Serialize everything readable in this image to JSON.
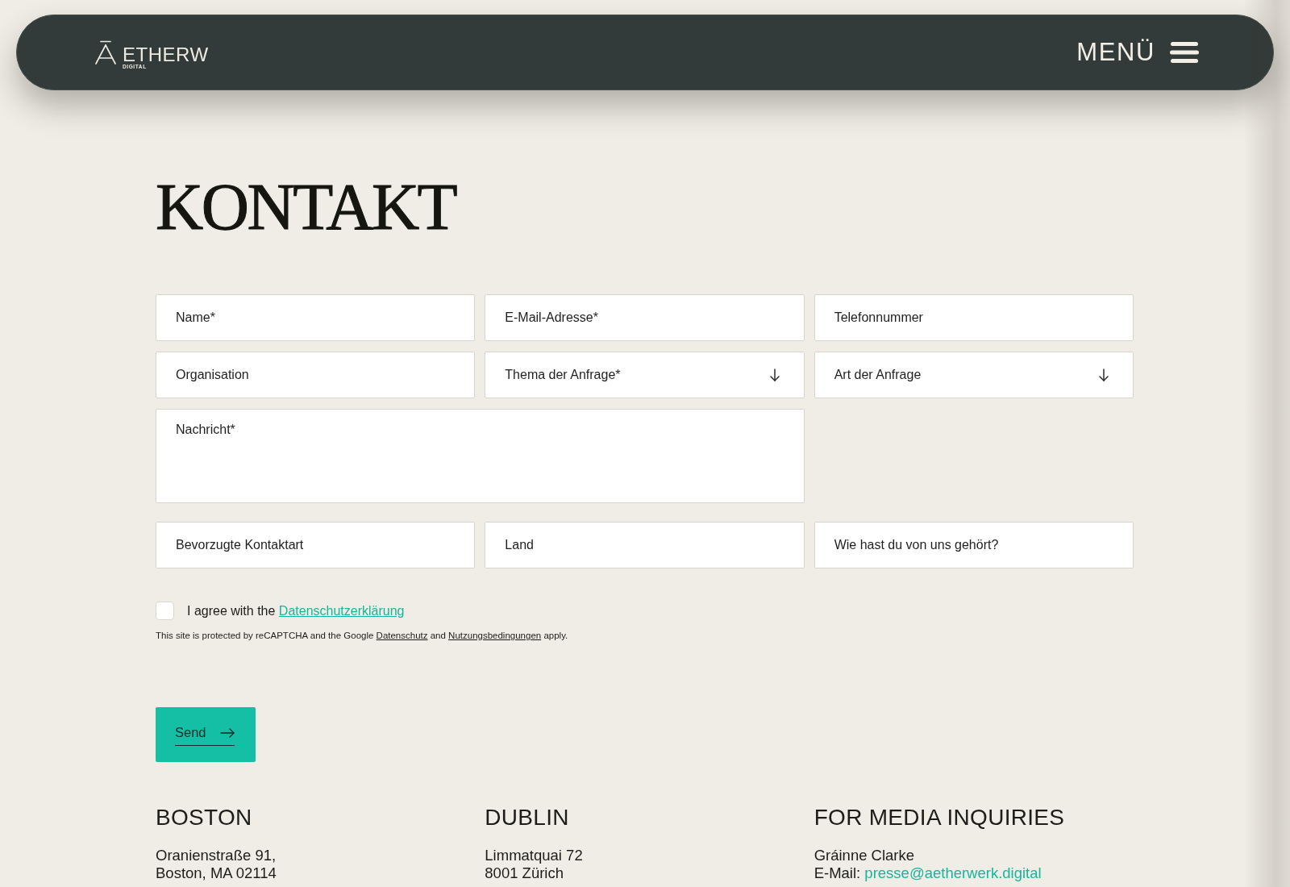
{
  "header": {
    "logo": {
      "wordmark": "ETHERW",
      "tagline": "DIGITAL"
    },
    "menu": {
      "label": "MENÜ"
    }
  },
  "title": "KONTAKT",
  "form": {
    "rows": [
      [
        {
          "kind": "input",
          "placeholder": "Name*"
        },
        {
          "kind": "input",
          "placeholder": "E-Mail-Adresse*"
        },
        {
          "kind": "input",
          "placeholder": "Telefonnummer"
        }
      ],
      [
        {
          "kind": "input",
          "placeholder": "Organisation"
        },
        {
          "kind": "select",
          "label": "Thema der Anfrage*"
        },
        {
          "kind": "select",
          "label": "Art der Anfrage"
        }
      ],
      [
        {
          "kind": "textarea",
          "placeholder": "Nachricht*"
        }
      ],
      [
        {
          "kind": "input",
          "placeholder": "Bevorzugte Kontaktart"
        },
        {
          "kind": "input",
          "placeholder": "Land"
        },
        {
          "kind": "input",
          "placeholder": "Wie hast du von uns gehört?"
        }
      ]
    ],
    "consent": {
      "checked": false,
      "parts": [
        {
          "kind": "text",
          "text": "I agree with the "
        },
        {
          "kind": "link",
          "text": "Datenschutzerklärung"
        }
      ]
    },
    "notice": {
      "parts": [
        {
          "kind": "text",
          "text": "This site is protected by reCAPTCHA and the Google "
        },
        {
          "kind": "link",
          "text": "Datenschutz"
        },
        {
          "kind": "text",
          "text": " and "
        },
        {
          "kind": "link",
          "text": "Nutzungsbedingungen"
        },
        {
          "kind": "text",
          "text": " apply."
        }
      ]
    },
    "submit": {
      "label": "Send"
    }
  },
  "offices": [
    {
      "heading": "BOSTON",
      "lines": [
        {
          "parts": [
            {
              "kind": "text",
              "text": "Oranienstraße 91,"
            }
          ]
        },
        {
          "parts": [
            {
              "kind": "text",
              "text": "Boston, MA 02114"
            }
          ]
        }
      ]
    },
    {
      "heading": "DUBLIN",
      "lines": [
        {
          "parts": [
            {
              "kind": "text",
              "text": "Limmatquai 72"
            }
          ]
        },
        {
          "parts": [
            {
              "kind": "text",
              "text": "8001 Zürich"
            }
          ]
        }
      ]
    },
    {
      "heading": "FOR MEDIA INQUIRIES",
      "lines": [
        {
          "parts": [
            {
              "kind": "text",
              "text": "Gráinne Clarke"
            }
          ]
        },
        {
          "parts": [
            {
              "kind": "text",
              "text": "E-Mail: "
            },
            {
              "kind": "link",
              "text": "presse@aetherwerk.digital"
            }
          ]
        }
      ]
    }
  ]
}
